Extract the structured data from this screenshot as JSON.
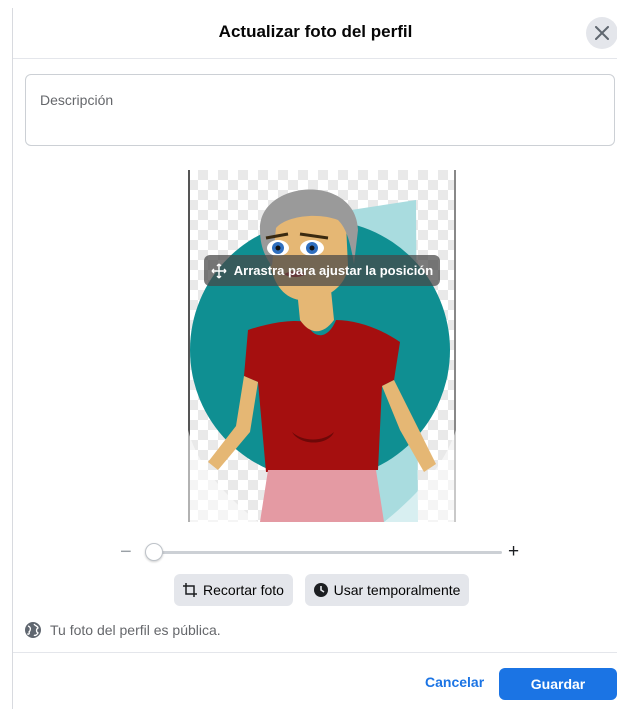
{
  "dialog": {
    "title": "Actualizar foto del perfil",
    "close_icon": "close-icon"
  },
  "description": {
    "placeholder": "Descripción"
  },
  "editor": {
    "drag_hint": "Arrastra para ajustar la posición",
    "move_icon": "move-arrows-icon"
  },
  "zoom": {
    "minus": "−",
    "plus": "+",
    "level": 0.0
  },
  "actions": {
    "crop_label": "Recortar foto",
    "crop_icon": "crop-icon",
    "temporary_label": "Usar temporalmente",
    "temporary_icon": "clock-icon"
  },
  "privacy": {
    "text": "Tu foto del perfil es pública.",
    "icon": "globe-icon"
  },
  "footer": {
    "cancel_label": "Cancelar",
    "save_label": "Guardar"
  },
  "colors": {
    "accent": "#1b74e4",
    "teal": "#0e8f93",
    "shirt": "#a50f0f",
    "skin": "#e5b774"
  }
}
